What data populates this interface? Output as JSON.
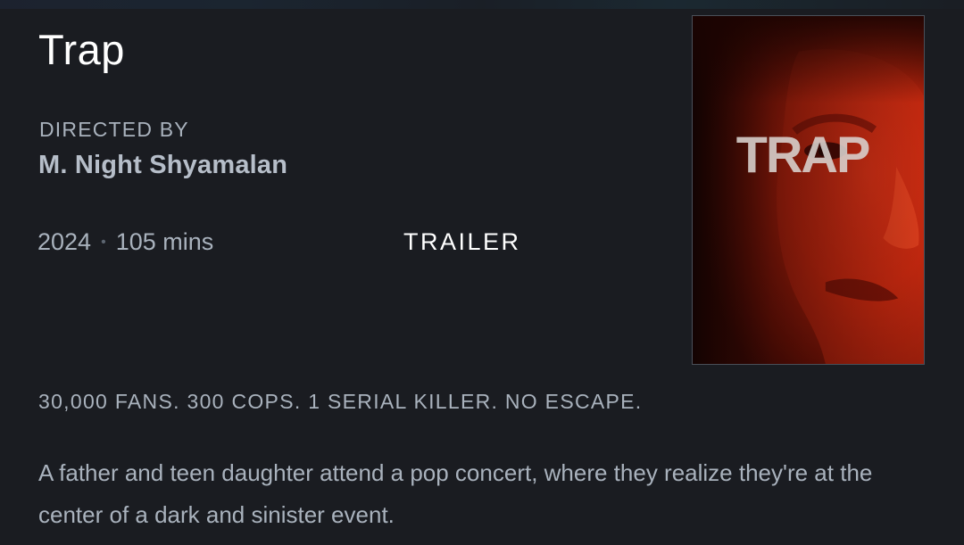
{
  "film": {
    "title": "Trap",
    "directed_label": "DIRECTED BY",
    "director": "M. Night Shyamalan",
    "year": "2024",
    "separator": "•",
    "runtime": "105 mins",
    "trailer_label": "TRAILER",
    "poster_title_text": "TRAP",
    "tagline": "30,000 FANS. 300 COPS. 1 SERIAL KILLER. NO ESCAPE.",
    "synopsis": "A father and teen daughter attend a pop concert, where they realize they're at the center of a dark and sinister event."
  },
  "colors": {
    "background": "#1a1c21",
    "title": "#ffffff",
    "muted_text": "#a9b2bd",
    "director_text": "#b6bec9",
    "poster_red": "#c0260e"
  }
}
